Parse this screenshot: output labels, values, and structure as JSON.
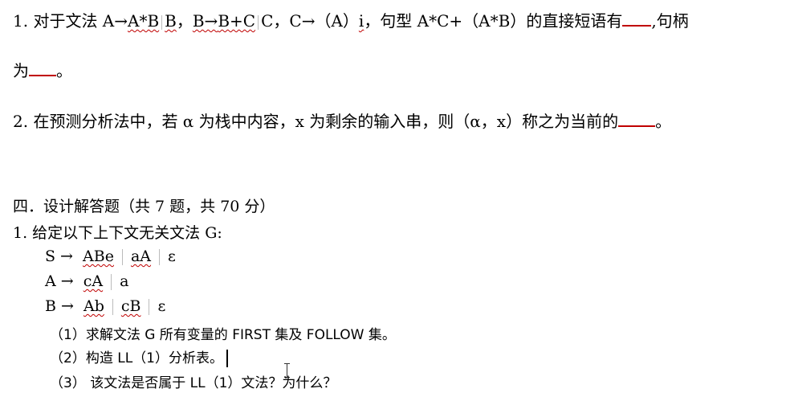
{
  "q1": {
    "line1_prefix": "1. 对于文法 ",
    "p1_lhs": "A→",
    "p1_rhs1": "A*B",
    "p1_rhs2": "B",
    "sep": "，",
    "p2_lhs": "B→",
    "p2_rhs1": "B+C",
    "p2_rhs2": "C",
    "p3": "C→（A）",
    "p3_i": "i",
    "mid": "，句型 A*C+（A*B）的直接短语有",
    "end1": ",句柄",
    "line2_prefix": "为",
    "line2_end": "。"
  },
  "q2": {
    "text": "2. 在预测分析法中，若 α 为栈中内容，x 为剩余的输入串，则（α，x）称之为当前的",
    "end": "。"
  },
  "section": {
    "title": "四．设计解答题（共 7 题，共 70 分）"
  },
  "design_q1": {
    "intro": "1.  给定以下上下文无关文法 G:",
    "rules": [
      {
        "lhs": "S →",
        "alts": [
          "ABe",
          "aA",
          "ε"
        ],
        "wavy": [
          true,
          true,
          false
        ]
      },
      {
        "lhs": "A  →",
        "alts": [
          "cA",
          "a"
        ],
        "wavy": [
          true,
          false
        ]
      },
      {
        "lhs": "B  →",
        "alts": [
          "Ab",
          "cB",
          "ε"
        ],
        "wavy": [
          true,
          true,
          false
        ]
      }
    ],
    "sub1": "（1）求解文法 G 所有变量的 FIRST 集及 FOLLOW 集。",
    "sub2": "（2）构造 LL（1）分析表。",
    "sub3": "（3） 该文法是否属于 LL（1）文法？为什么？"
  }
}
